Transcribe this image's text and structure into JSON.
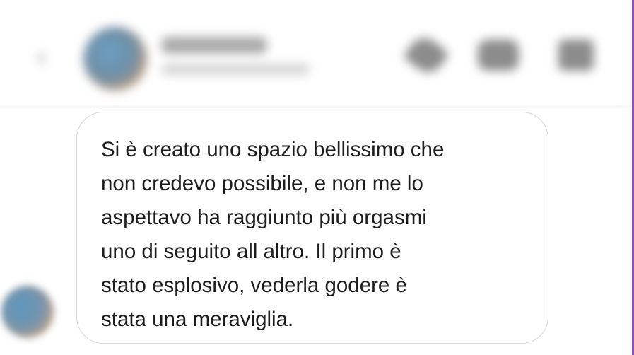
{
  "chat_header": {
    "back_icon": "chevron-left-icon",
    "contact_avatar": "avatar",
    "actions": [
      "phone-icon",
      "video-camera-icon",
      "info-icon"
    ]
  },
  "message": {
    "text": "Si è creato uno spazio bellissimo che\nnon credevo possibile, e non me lo\naspettavo ha raggiunto più orgasmi\nuno di seguito all altro. Il primo è\nstato esplosivo, vederla godere è\nstata una meraviglia."
  },
  "colors": {
    "bubble_border": "#d7d7d7",
    "text": "#1d1d1d",
    "accent_edge": "#8e4fc4"
  }
}
